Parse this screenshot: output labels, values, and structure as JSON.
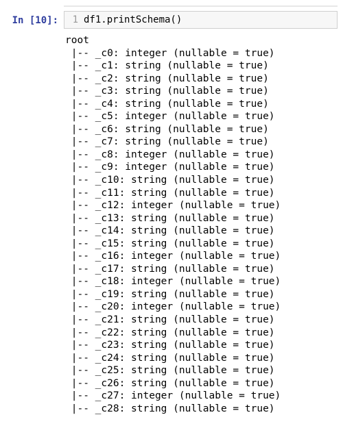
{
  "cell": {
    "prompt_label": "In [10]:",
    "line_number": "1",
    "code": "df1.printSchema()"
  },
  "output": {
    "root_label": "root",
    "schema": [
      {
        "name": "_c0",
        "type": "integer",
        "nullable": true
      },
      {
        "name": "_c1",
        "type": "string",
        "nullable": true
      },
      {
        "name": "_c2",
        "type": "string",
        "nullable": true
      },
      {
        "name": "_c3",
        "type": "string",
        "nullable": true
      },
      {
        "name": "_c4",
        "type": "string",
        "nullable": true
      },
      {
        "name": "_c5",
        "type": "integer",
        "nullable": true
      },
      {
        "name": "_c6",
        "type": "string",
        "nullable": true
      },
      {
        "name": "_c7",
        "type": "string",
        "nullable": true
      },
      {
        "name": "_c8",
        "type": "integer",
        "nullable": true
      },
      {
        "name": "_c9",
        "type": "integer",
        "nullable": true
      },
      {
        "name": "_c10",
        "type": "string",
        "nullable": true
      },
      {
        "name": "_c11",
        "type": "string",
        "nullable": true
      },
      {
        "name": "_c12",
        "type": "integer",
        "nullable": true
      },
      {
        "name": "_c13",
        "type": "string",
        "nullable": true
      },
      {
        "name": "_c14",
        "type": "string",
        "nullable": true
      },
      {
        "name": "_c15",
        "type": "string",
        "nullable": true
      },
      {
        "name": "_c16",
        "type": "integer",
        "nullable": true
      },
      {
        "name": "_c17",
        "type": "string",
        "nullable": true
      },
      {
        "name": "_c18",
        "type": "integer",
        "nullable": true
      },
      {
        "name": "_c19",
        "type": "string",
        "nullable": true
      },
      {
        "name": "_c20",
        "type": "integer",
        "nullable": true
      },
      {
        "name": "_c21",
        "type": "string",
        "nullable": true
      },
      {
        "name": "_c22",
        "type": "string",
        "nullable": true
      },
      {
        "name": "_c23",
        "type": "string",
        "nullable": true
      },
      {
        "name": "_c24",
        "type": "string",
        "nullable": true
      },
      {
        "name": "_c25",
        "type": "string",
        "nullable": true
      },
      {
        "name": "_c26",
        "type": "string",
        "nullable": true
      },
      {
        "name": "_c27",
        "type": "integer",
        "nullable": true
      },
      {
        "name": "_c28",
        "type": "string",
        "nullable": true
      }
    ]
  }
}
